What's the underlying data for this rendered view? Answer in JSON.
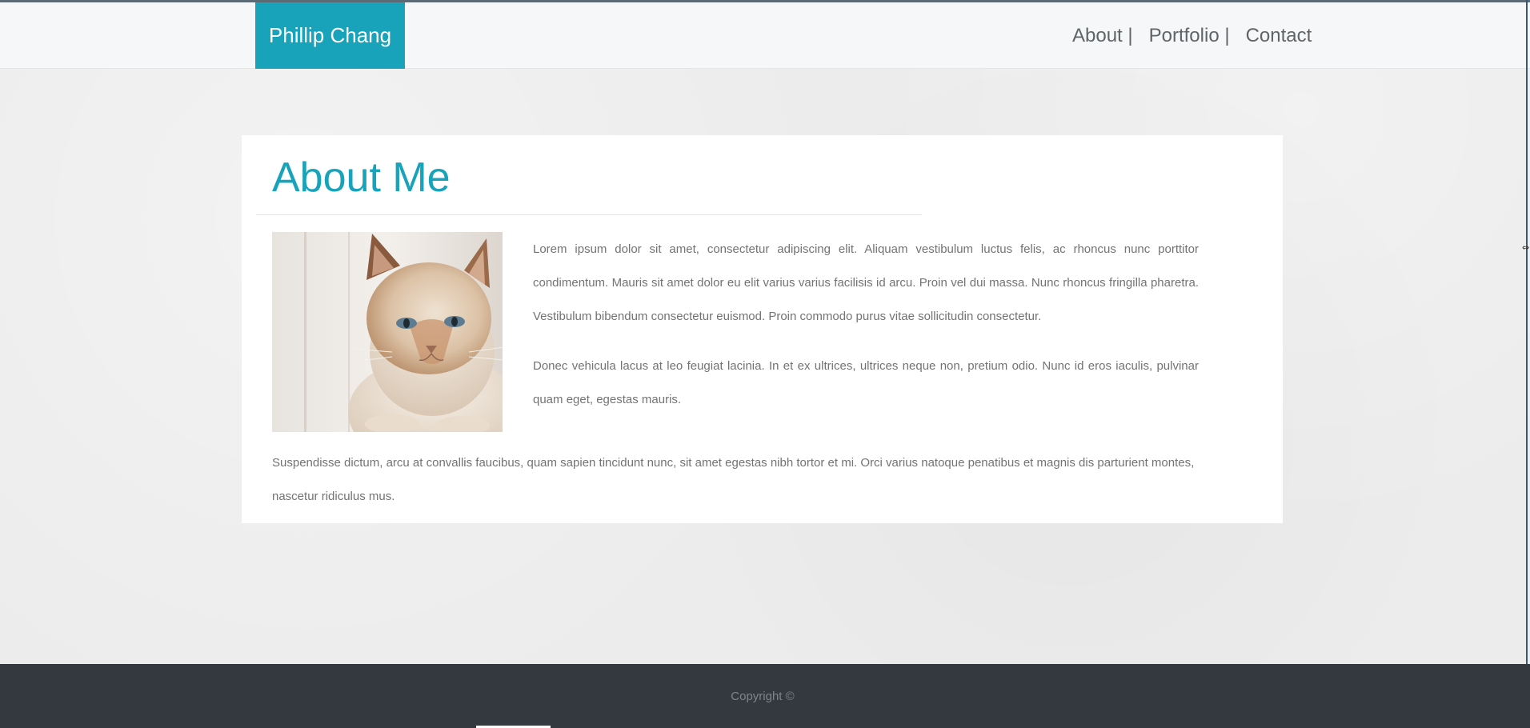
{
  "header": {
    "brand": "Phillip Chang",
    "nav": [
      {
        "label": "About |"
      },
      {
        "label": "Portfolio |"
      },
      {
        "label": "Contact"
      }
    ]
  },
  "main": {
    "title": "About Me",
    "image": {
      "alt": "cat-photo"
    },
    "paragraphs": [
      "Lorem ipsum dolor sit amet, consectetur adipiscing elit. Aliquam vestibulum luctus felis, ac rhoncus nunc porttitor condimentum. Mauris sit amet dolor eu elit varius varius facilisis id arcu. Proin vel dui massa. Nunc rhoncus fringilla pharetra. Vestibulum bibendum consectetur euismod. Proin commodo purus vitae sollicitudin consectetur.",
      "Donec vehicula lacus at leo feugiat lacinia. In et ex ultrices, ultrices neque non, pretium odio. Nunc id eros iaculis, pulvinar quam eget, egestas mauris.",
      "Suspendisse dictum, arcu at convallis faucibus, quam sapien tincidunt nunc, sit amet egestas nibh tortor et mi. Orci varius natoque penatibus et magnis dis parturient montes, nascetur ridiculus mus."
    ]
  },
  "footer": {
    "copyright": "Copyright ©"
  },
  "colors": {
    "accent": "#18a3bb",
    "footer_bg": "#343940",
    "page_bg": "#ececec"
  }
}
